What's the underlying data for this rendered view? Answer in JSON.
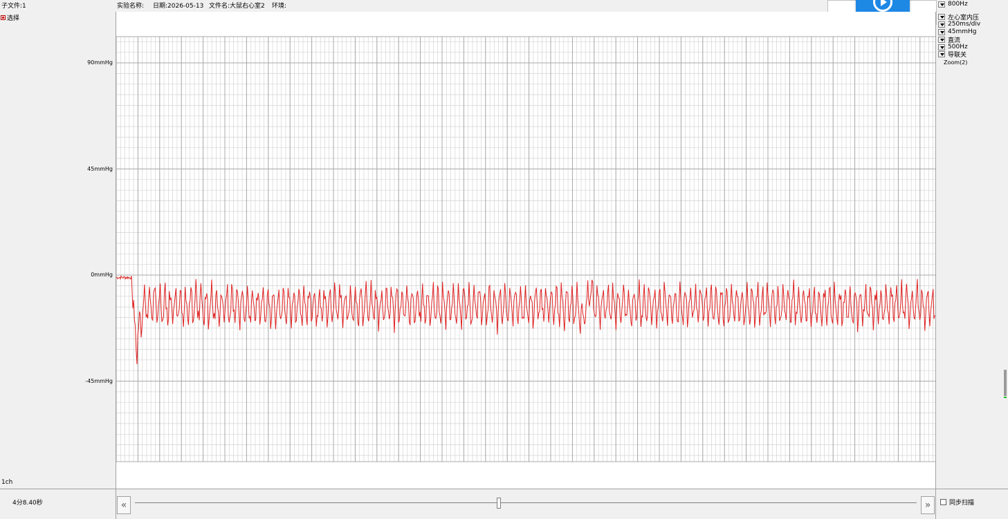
{
  "header": {
    "subfile": "子文件:1",
    "experiment_label": "实验名称:",
    "date": "日期:2026-05-13",
    "filename": "文件名:大鼠右心室2",
    "environment": "环境:"
  },
  "left": {
    "select_label": "选择",
    "channel_label": "1ch",
    "y_ticks": [
      "90mmHg",
      "45mmHg",
      "0mmHg",
      "-45mmHg"
    ]
  },
  "right_panel": {
    "top_filter": "800Hz",
    "items": [
      "左心室内压",
      "250ms/div",
      "45mmHg",
      "直流",
      "500Hz",
      "导联关"
    ],
    "zoom": "Zoom(2)"
  },
  "bottom": {
    "time": "4分8.40秒",
    "sync_scan_label": "同步扫描"
  },
  "colors": {
    "trace": "#e02020",
    "grid_major": "#a8a8a8",
    "grid_minor": "#d4d4d4",
    "play_button": "#1e88e5"
  },
  "chart_data": {
    "type": "line",
    "title": "",
    "xlabel": "",
    "ylabel": "",
    "ylim": [
      -90,
      100
    ],
    "y_ticks": [
      90,
      45,
      0,
      -45
    ],
    "y_unit": "mmHg",
    "grid": true,
    "series": [
      {
        "baseline_start": -1,
        "baseline_mean": -13,
        "amplitude": 14,
        "cycles": 155
      }
    ]
  }
}
